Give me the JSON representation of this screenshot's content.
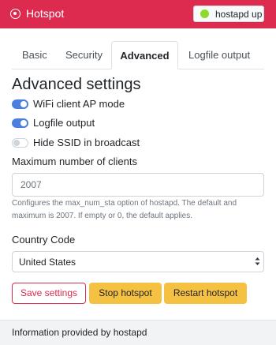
{
  "header": {
    "title": "Hotspot",
    "status_label": "hostapd up",
    "status_color": "#8bdc2a",
    "accent_color": "#dc2b4e"
  },
  "tabs": [
    {
      "label": "Basic",
      "active": false
    },
    {
      "label": "Security",
      "active": false
    },
    {
      "label": "Advanced",
      "active": true
    },
    {
      "label": "Logfile output",
      "active": false
    }
  ],
  "section": {
    "title": "Advanced settings"
  },
  "switches": [
    {
      "label": "WiFi client AP mode",
      "on": true
    },
    {
      "label": "Logfile output",
      "on": true
    },
    {
      "label": "Hide SSID in broadcast",
      "on": false
    }
  ],
  "max_clients": {
    "label": "Maximum number of clients",
    "placeholder": "2007",
    "help": "Configures the max_num_sta option of hostapd. The default and maximum is 2007. If empty or 0, the default applies."
  },
  "country": {
    "label": "Country Code",
    "selected": "United States"
  },
  "buttons": {
    "save": "Save settings",
    "stop": "Stop hotspot",
    "restart": "Restart hotspot"
  },
  "footer": {
    "text": "Information provided by hostapd"
  }
}
